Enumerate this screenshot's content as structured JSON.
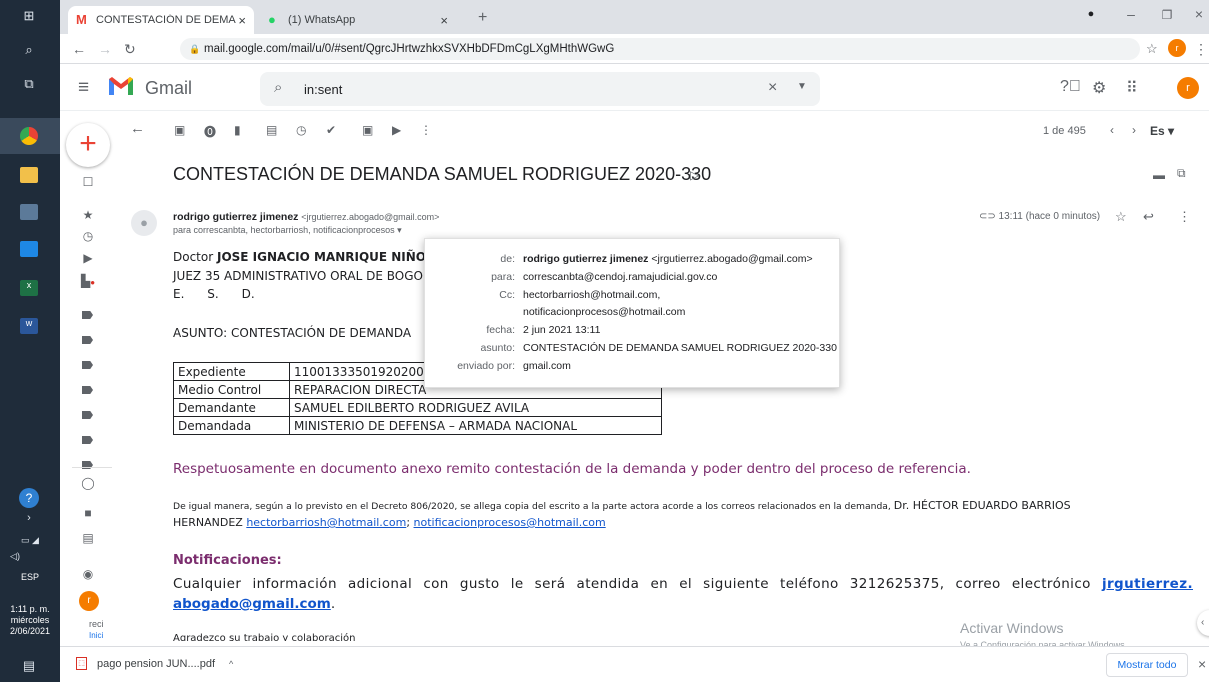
{
  "taskbar": {
    "language": "ESP",
    "time": "1:11 p. m.",
    "day": "miércoles",
    "date": "2/06/2021"
  },
  "browser": {
    "tabs": [
      {
        "title": "CONTESTACIÓN DE DEMANDA S",
        "active": true
      },
      {
        "title": "(1) WhatsApp",
        "active": false
      }
    ],
    "url": "mail.google.com/mail/u/0/#sent/QgrcJHrtwzhkxSVXHbDFDmCgLXgMHthWGwG"
  },
  "gmail": {
    "app_name": "Gmail",
    "search_value": "in:sent",
    "avatar_letter": "r",
    "page_info": "1 de 495",
    "lang_button": "Es",
    "rail_more_label": "reci",
    "rail_more_label2": "Inici"
  },
  "message": {
    "subject": "CONTESTACIÓN DE DEMANDA SAMUEL RODRIGUEZ 2020-330",
    "sender_name": "rodrigo gutierrez jimenez",
    "sender_email": "<jrgutierrez.abogado@gmail.com>",
    "recipients_line": "para correscanbta, hectorbarriosh, notificacionprocesos",
    "time": "13:11 (hace 0 minutos)",
    "salutation_prefix": "Doctor ",
    "salutation_name": "JOSE IGNACIO MANRIQUE NIÑO",
    "court_line": "JUEZ 35 ADMINISTRATIVO ORAL DE BOGO",
    "esd_line": "E.      S.      D.",
    "asunto_line": "ASUNTO: CONTESTACIÓN DE DEMANDA",
    "table": [
      {
        "key": "Expediente",
        "value": "110013335019202000"
      },
      {
        "key": "Medio Control",
        "value": "REPARACION DIRECTA"
      },
      {
        "key": "Demandante",
        "value": "SAMUEL EDILBERTO RODRIGUEZ AVILA"
      },
      {
        "key": "Demandada",
        "value": "MINISTERIO DE DEFENSA – ARMADA NACIONAL"
      }
    ],
    "paragraph1": "Respetuosamente en documento anexo remito contestación de la demanda y poder dentro del proceso de referencia.",
    "paragraph2a": "De igual manera, según a lo previsto en el Decreto 806/2020, se allega copia del escrito a la parte actora acorde a los correos  relacionados en la demanda,",
    "paragraph2b": "Dr. HÉCTOR EDUARDO BARRIOS",
    "paragraph2c": "HERNANDEZ",
    "link1": "hectorbarriosh@hotmail.com",
    "link_sep": ";",
    "link2": "notificacionprocesos@hotmail.com",
    "notif_title": "Notificaciones:",
    "notif_text": "Cualquier información adicional con gusto le será atendida en el siguiente teléfono 3212625375, correo electrónico",
    "notif_link1": "jrgutierrez.",
    "notif_link2": "abogado@gmail.com",
    "notif_end": ".",
    "closing": "Agradezco su trabajo y colaboración"
  },
  "details_popup": {
    "rows": [
      {
        "label": "de:",
        "value_bold": "rodrigo gutierrez jimenez",
        "value": " <jrgutierrez.abogado@gmail.com>"
      },
      {
        "label": "para:",
        "value": "correscanbta@cendoj.ramajudicial.gov.co"
      },
      {
        "label": "Cc:",
        "value": "hectorbarriosh@hotmail.com,"
      },
      {
        "label": "",
        "value": "notificacionprocesos@hotmail.com"
      },
      {
        "label": "fecha:",
        "value": "2 jun 2021 13:11"
      },
      {
        "label": "asunto:",
        "value": "CONTESTACIÓN DE DEMANDA SAMUEL RODRIGUEZ 2020-330"
      },
      {
        "label": "enviado por:",
        "value": "gmail.com"
      }
    ]
  },
  "download_bar": {
    "file": "pago pension JUN....pdf",
    "show_all": "Mostrar todo"
  },
  "watermark": {
    "title": "Activar Windows",
    "subtitle": "Ve a Configuración para activar Windows."
  },
  "colors": {
    "taskbar": "#1f2c3a",
    "link": "#1155cc",
    "purple_text": "#7b2d6e",
    "accent_orange": "#f57c00"
  }
}
